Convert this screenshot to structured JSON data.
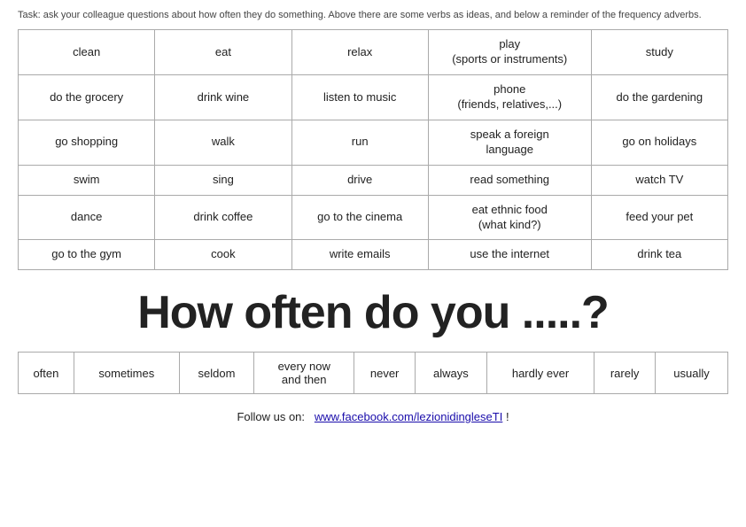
{
  "task": {
    "text": "Task: ask your colleague questions about how often they do something. Above there are some verbs as ideas, and below a reminder of the frequency adverbs."
  },
  "verbs_table": {
    "rows": [
      [
        "clean",
        "eat",
        "relax",
        "play\n(sports or instruments)",
        "study"
      ],
      [
        "do the grocery",
        "drink wine",
        "listen to music",
        "phone\n(friends, relatives,...)",
        "do the gardening"
      ],
      [
        "go shopping",
        "walk",
        "run",
        "speak a foreign\nlanguage",
        "go on holidays"
      ],
      [
        "swim",
        "sing",
        "drive",
        "read something",
        "watch TV"
      ],
      [
        "dance",
        "drink coffee",
        "go to the cinema",
        "eat ethnic food\n(what kind?)",
        "feed your pet"
      ],
      [
        "go to the gym",
        "cook",
        "write emails",
        "use the internet",
        "drink tea"
      ]
    ]
  },
  "big_question": "How often do you .....?",
  "adverbs": [
    "often",
    "sometimes",
    "seldom",
    "every now\nand then",
    "never",
    "always",
    "hardly ever",
    "rarely",
    "usually"
  ],
  "follow_us": {
    "label": "Follow us on:",
    "link_text": "www.facebook.com/lezionidingleseTI",
    "link_url": "#",
    "suffix": " !"
  }
}
